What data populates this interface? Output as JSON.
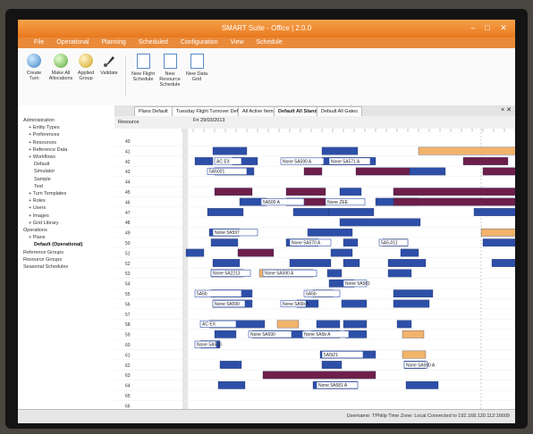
{
  "window": {
    "title": "SMART Suite - Office | 2.0.0",
    "minimize": "–",
    "maximize": "□",
    "close": "✕"
  },
  "menu": [
    "File",
    "Operational",
    "Planning",
    "Scheduled",
    "Configuration",
    "View",
    "Schedule"
  ],
  "ribbon": {
    "buttons": [
      {
        "label": "Create Turn",
        "icon": "globe-icon"
      },
      {
        "label": "Make All Allocations",
        "icon": "refresh-icon"
      },
      {
        "label": "Applied Group",
        "icon": "group-icon"
      },
      {
        "label": "Validate",
        "icon": "brush-icon"
      },
      {
        "label": "New Flight Schedule",
        "icon": "document-icon"
      },
      {
        "label": "New Resource Schedule",
        "icon": "calendar-icon"
      },
      {
        "label": "New Data Grid",
        "icon": "grid-icon"
      }
    ]
  },
  "tabs": [
    "Plans Default",
    "Tuesday Flight Turnover Default",
    "All Active Items",
    "Default All Stands",
    "Default All Gates"
  ],
  "tab_close": "× ✕",
  "sidebar": {
    "items": [
      {
        "label": "Administration",
        "level": 0,
        "bold": false
      },
      {
        "label": "Entity Types",
        "level": 1,
        "bold": false
      },
      {
        "label": "Preferences",
        "level": 1,
        "bold": false
      },
      {
        "label": "Resources",
        "level": 1,
        "bold": false
      },
      {
        "label": "Reference Data",
        "level": 1,
        "bold": false
      },
      {
        "label": "Workflows",
        "level": 1,
        "bold": false
      },
      {
        "label": "Default",
        "level": 2,
        "bold": false
      },
      {
        "label": "Simulator",
        "level": 2,
        "bold": false
      },
      {
        "label": "Sample",
        "level": 2,
        "bold": false
      },
      {
        "label": "Test",
        "level": 2,
        "bold": false
      },
      {
        "label": "Turn Templates",
        "level": 1,
        "bold": false
      },
      {
        "label": "Roles",
        "level": 1,
        "bold": false
      },
      {
        "label": "Users",
        "level": 1,
        "bold": false
      },
      {
        "label": "Images",
        "level": 1,
        "bold": false
      },
      {
        "label": "Grid Library",
        "level": 1,
        "bold": false
      },
      {
        "label": "Operations",
        "level": 0,
        "bold": false
      },
      {
        "label": "Plans",
        "level": 1,
        "bold": false
      },
      {
        "label": "Default (Operational)",
        "level": 2,
        "bold": true
      },
      {
        "label": "Reference Groups",
        "level": 0,
        "bold": false
      },
      {
        "label": "Resource Groups",
        "level": 0,
        "bold": false
      },
      {
        "label": "Seasonal Schedules",
        "level": 0,
        "bold": false
      }
    ]
  },
  "schedule": {
    "row_header": "Resource",
    "date": "Fri 29/03/2013",
    "rows": [
      "40",
      "41",
      "42",
      "43",
      "44",
      "45",
      "46",
      "47",
      "48",
      "49",
      "50",
      "51",
      "52",
      "53",
      "54",
      "55",
      "56",
      "57",
      "58",
      "59",
      "60",
      "61",
      "62",
      "63",
      "64",
      "65",
      "66"
    ],
    "colors": {
      "blue": "#2d4fa8",
      "purple": "#6d1f4a",
      "orange": "#f2b36a",
      "blue_outline": "#ffffff"
    },
    "bar_texts": [
      "AC EX",
      "None 5A590 A",
      "None 5A571 A",
      "5A5001",
      "5A500 A",
      "None ZEE",
      "None 5A597",
      "None 5A570 A",
      "5A5-011",
      "None 5A2213",
      "None 5A590 A",
      "None 5A581",
      "5A5b",
      "5A5b",
      "None 5A590",
      "None 5A5b A",
      "AC EX",
      "None 5A590",
      "None 5A5b A",
      "None 5A590",
      "5A5t21",
      "None 5A590 A",
      "None 5A581 A"
    ]
  },
  "status": {
    "text": "Username: TPhilip   Time Zone: Local   Connected to 192.168.120.112:16609"
  }
}
